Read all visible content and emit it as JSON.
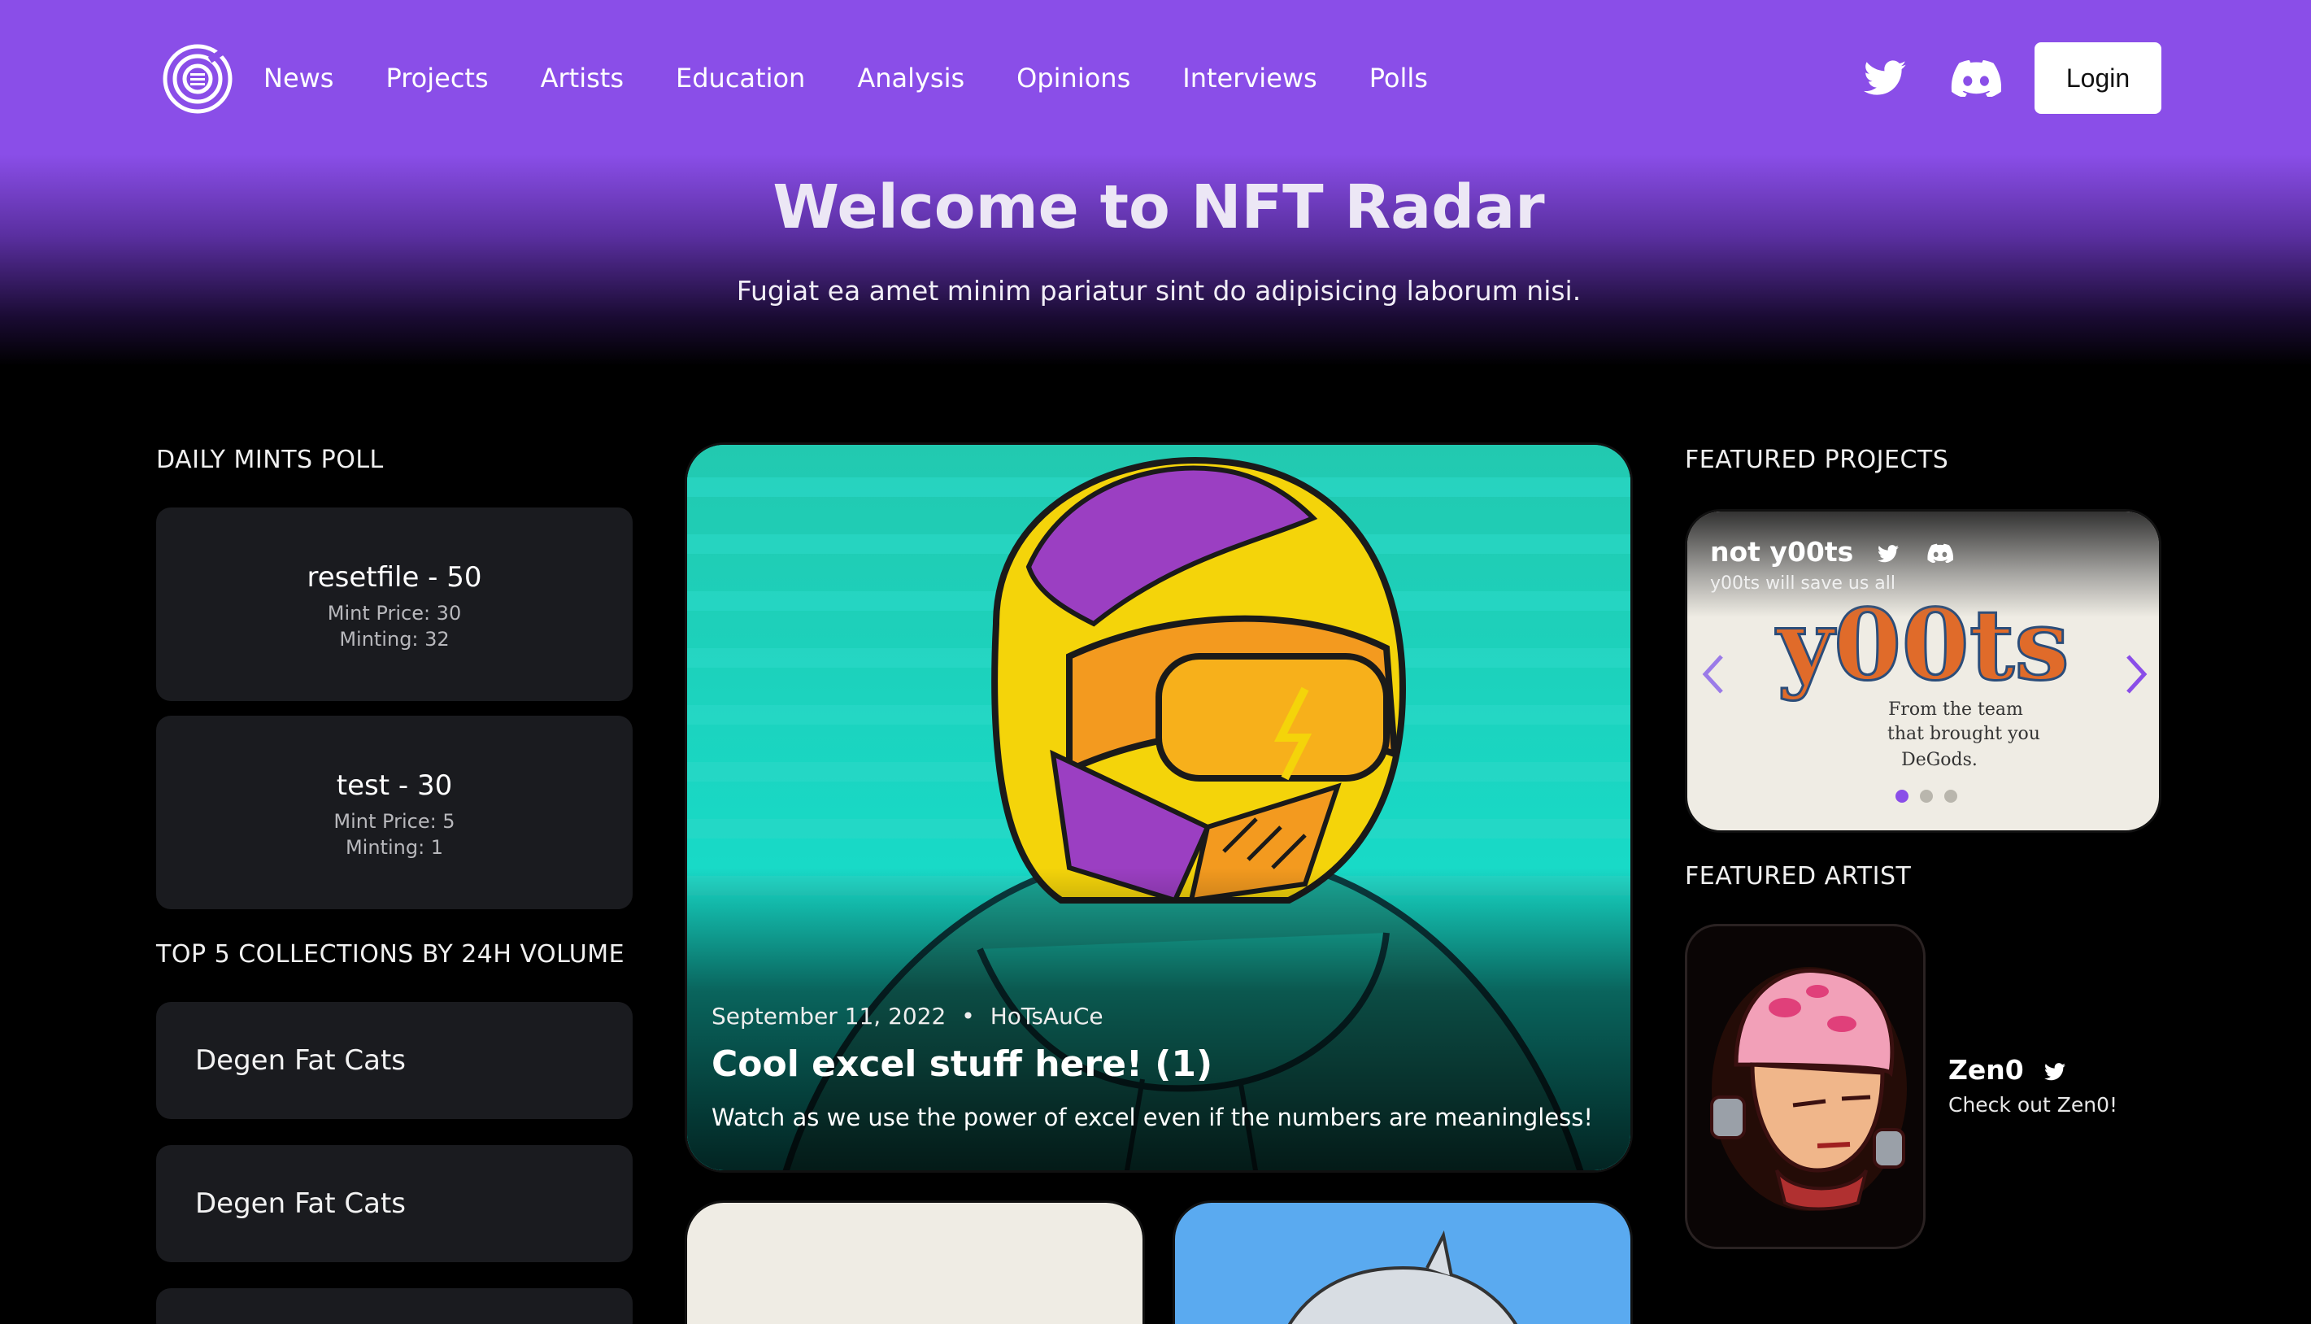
{
  "nav": {
    "links": [
      "News",
      "Projects",
      "Artists",
      "Education",
      "Analysis",
      "Opinions",
      "Interviews",
      "Polls"
    ],
    "twitter_icon": "twitter-icon",
    "discord_icon": "discord-icon",
    "login_label": "Login"
  },
  "hero": {
    "title": "Welcome to NFT Radar",
    "subtitle": "Fugiat ea amet minim pariatur sint do adipisicing laborum nisi."
  },
  "daily_mints": {
    "label": "DAILY MINTS POLL",
    "items": [
      {
        "title": "resetfile - 50",
        "price": "Mint Price: 30",
        "minting": "Minting: 32"
      },
      {
        "title": "test - 30",
        "price": "Mint Price: 5",
        "minting": "Minting: 1"
      }
    ]
  },
  "top_collections": {
    "label": "TOP 5 COLLECTIONS BY 24H VOLUME",
    "items": [
      "Degen Fat Cats",
      "Degen Fat Cats"
    ]
  },
  "main_post": {
    "date": "September 11, 2022",
    "separator": "•",
    "author": "HoTsAuCe",
    "title": "Cool excel stuff here! (1)",
    "description": "Watch as we use the power of excel even if the numbers are meaningless!"
  },
  "featured_projects": {
    "label": "FEATURED PROJECTS",
    "name": "not y00ts",
    "tagline": "y00ts will save us all",
    "image_text": "y00ts",
    "image_subtext": [
      "From the team",
      "that brought you",
      "DeGods."
    ],
    "slide_count": 3,
    "active_slide": 1
  },
  "featured_artist": {
    "label": "FEATURED ARTIST",
    "name": "Zen0",
    "description": "Check out Zen0!"
  },
  "colors": {
    "accent": "#8a4ee8",
    "card_bg": "#1a1b1f"
  }
}
